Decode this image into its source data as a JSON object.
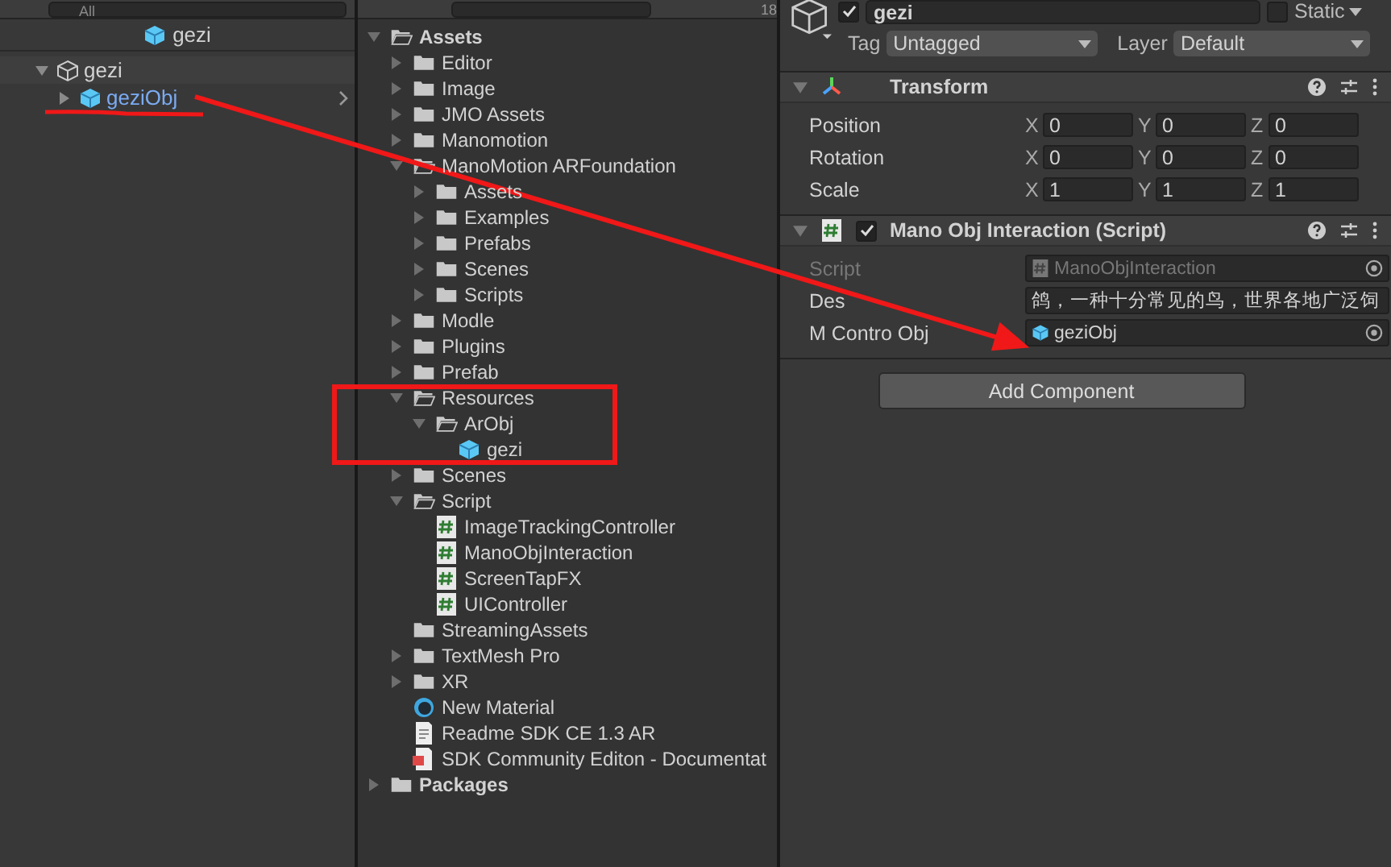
{
  "hierarchy": {
    "search": {
      "placeholder": "All"
    },
    "scene": "gezi",
    "items": [
      {
        "label": "gezi",
        "kind": "object",
        "expanded": true,
        "children": [
          {
            "label": "geziObj",
            "kind": "prefab",
            "expanded": false
          }
        ]
      }
    ]
  },
  "project": {
    "count": "18",
    "items": [
      {
        "label": "Assets",
        "kind": "folder",
        "expanded": true,
        "children": [
          {
            "label": "Editor",
            "kind": "folder",
            "expanded": false
          },
          {
            "label": "Image",
            "kind": "folder",
            "expanded": false
          },
          {
            "label": "JMO Assets",
            "kind": "folder",
            "expanded": false
          },
          {
            "label": "Manomotion",
            "kind": "folder",
            "expanded": false
          },
          {
            "label": "ManoMotion ARFoundation",
            "kind": "folder",
            "expanded": true,
            "children": [
              {
                "label": "Assets",
                "kind": "folder",
                "expanded": false
              },
              {
                "label": "Examples",
                "kind": "folder",
                "expanded": false
              },
              {
                "label": "Prefabs",
                "kind": "folder",
                "expanded": false
              },
              {
                "label": "Scenes",
                "kind": "folder",
                "expanded": false
              },
              {
                "label": "Scripts",
                "kind": "folder",
                "expanded": false
              }
            ]
          },
          {
            "label": "Modle",
            "kind": "folder",
            "expanded": false
          },
          {
            "label": "Plugins",
            "kind": "folder",
            "expanded": false
          },
          {
            "label": "Prefab",
            "kind": "folder",
            "expanded": false
          },
          {
            "label": "Resources",
            "kind": "folder",
            "expanded": true,
            "children": [
              {
                "label": "ArObj",
                "kind": "folder",
                "expanded": true,
                "children": [
                  {
                    "label": "gezi",
                    "kind": "prefab"
                  }
                ]
              }
            ]
          },
          {
            "label": "Scenes",
            "kind": "folder",
            "expanded": false
          },
          {
            "label": "Script",
            "kind": "folder",
            "expanded": true,
            "children": [
              {
                "label": "ImageTrackingController",
                "kind": "script"
              },
              {
                "label": "ManoObjInteraction",
                "kind": "script"
              },
              {
                "label": "ScreenTapFX",
                "kind": "script"
              },
              {
                "label": "UIController",
                "kind": "script"
              }
            ]
          },
          {
            "label": "StreamingAssets",
            "kind": "folder"
          },
          {
            "label": "TextMesh Pro",
            "kind": "folder",
            "expanded": false
          },
          {
            "label": "XR",
            "kind": "folder",
            "expanded": false
          },
          {
            "label": "New Material",
            "kind": "material"
          },
          {
            "label": "Readme SDK CE 1.3 AR",
            "kind": "text"
          },
          {
            "label": "SDK Community Editon - Documentat",
            "kind": "pdf"
          }
        ]
      },
      {
        "label": "Packages",
        "kind": "folder",
        "expanded": false
      }
    ]
  },
  "inspector": {
    "name": "gezi",
    "active": true,
    "static": false,
    "static_label": "Static",
    "tag_label": "Tag",
    "tag": "Untagged",
    "layer_label": "Layer",
    "layer": "Default",
    "components": [
      {
        "kind": "transform",
        "title": "Transform",
        "rows": [
          {
            "label": "Position",
            "values": [
              {
                "axis": "X",
                "value": "0"
              },
              {
                "axis": "Y",
                "value": "0"
              },
              {
                "axis": "Z",
                "value": "0"
              }
            ]
          },
          {
            "label": "Rotation",
            "values": [
              {
                "axis": "X",
                "value": "0"
              },
              {
                "axis": "Y",
                "value": "0"
              },
              {
                "axis": "Z",
                "value": "0"
              }
            ]
          },
          {
            "label": "Scale",
            "values": [
              {
                "axis": "X",
                "value": "1"
              },
              {
                "axis": "Y",
                "value": "1"
              },
              {
                "axis": "Z",
                "value": "1"
              }
            ]
          }
        ]
      },
      {
        "kind": "script",
        "title": "Mano Obj Interaction (Script)",
        "enabled": true,
        "fields": [
          {
            "label": "Script",
            "kind": "script_ref",
            "value": "ManoObjInteraction",
            "disabled": true
          },
          {
            "label": "Des",
            "kind": "text",
            "value": "鸽，一种十分常见的鸟，世界各地广泛饲",
            "disabled": false
          },
          {
            "label": "M Contro Obj",
            "kind": "object_ref",
            "value": "geziObj",
            "disabled": false
          }
        ]
      }
    ],
    "add_button": "Add Component"
  }
}
